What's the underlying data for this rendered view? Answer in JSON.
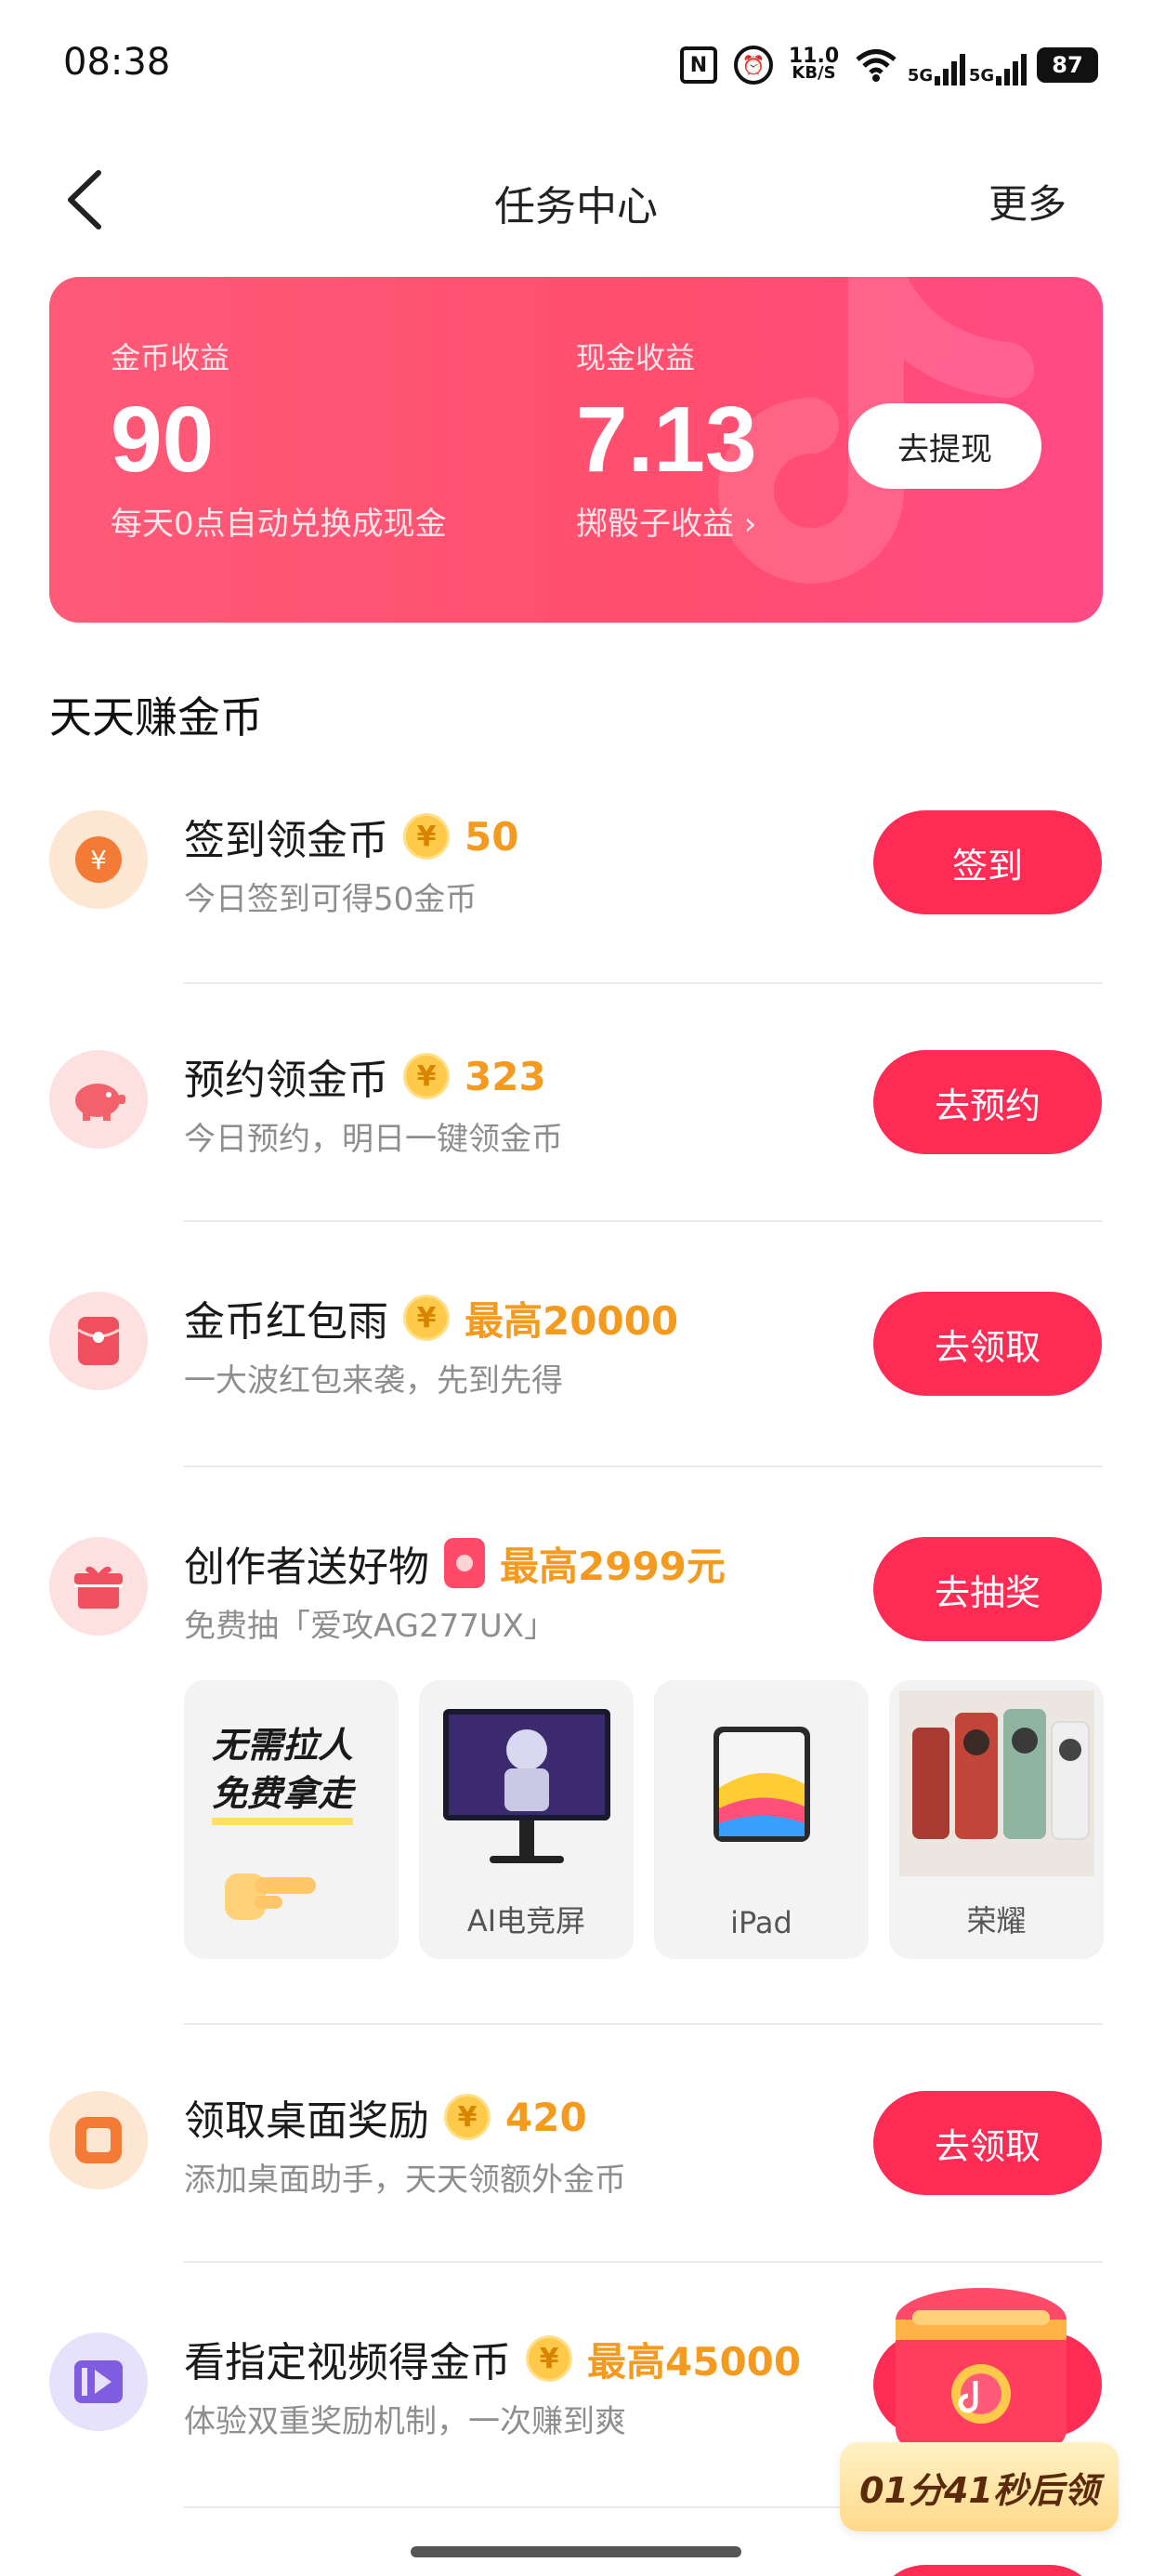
{
  "status_bar": {
    "time": "08:38",
    "nfc": "N",
    "net_speed_value": "11.0",
    "net_speed_unit": "KB/S",
    "sim1": "5G",
    "sim2": "5G",
    "battery": "87"
  },
  "header": {
    "title": "任务中心",
    "more": "更多"
  },
  "earnings": {
    "coins_label": "金币收益",
    "coins_value": "90",
    "coins_note": "每天0点自动兑换成现金",
    "cash_label": "现金收益",
    "cash_value": "7.13",
    "cash_note": "掷骰子收益 ›",
    "withdraw_button": "去提现",
    "accent_color": "#ff5070"
  },
  "section_title": "天天赚金币",
  "tasks": [
    {
      "title": "签到领金币",
      "reward_icon": "coin-icon",
      "reward": "50",
      "desc": "今日签到可得50金币",
      "button": "签到",
      "icon": "yen-coin-icon"
    },
    {
      "title": "预约领金币",
      "reward_icon": "coin-icon",
      "reward": "323",
      "desc": "今日预约，明日一键领金币",
      "button": "去预约",
      "icon": "piggy-bank-icon"
    },
    {
      "title": "金币红包雨",
      "reward_icon": "coin-icon",
      "reward": "最高20000",
      "desc": "一大波红包来袭，先到先得",
      "button": "去领取",
      "icon": "red-envelope-icon"
    },
    {
      "title": "创作者送好物",
      "reward_icon": "red-envelope-icon",
      "reward": "最高2999元",
      "desc": "免费抽「爱攻AG277UX」",
      "button": "去抽奖",
      "icon": "gift-icon"
    },
    {
      "title": "领取桌面奖励",
      "reward_icon": "coin-icon",
      "reward": "420",
      "desc": "添加桌面助手，天天领额外金币",
      "button": "去领取",
      "icon": "desktop-widget-icon"
    },
    {
      "title": "看指定视频得金币",
      "reward_icon": "coin-icon",
      "reward": "最高45000",
      "desc": "体验双重奖励机制，一次赚到爽",
      "button": "",
      "icon": "video-icon"
    }
  ],
  "prizes": {
    "promo_line1": "无需拉人",
    "promo_line2": "免费拿走",
    "items": [
      {
        "label": "AI电竞屏"
      },
      {
        "label": "iPad"
      },
      {
        "label": "荣耀"
      }
    ]
  },
  "float_reward": {
    "countdown": "01分41秒后领"
  },
  "coin_symbol": "¥"
}
